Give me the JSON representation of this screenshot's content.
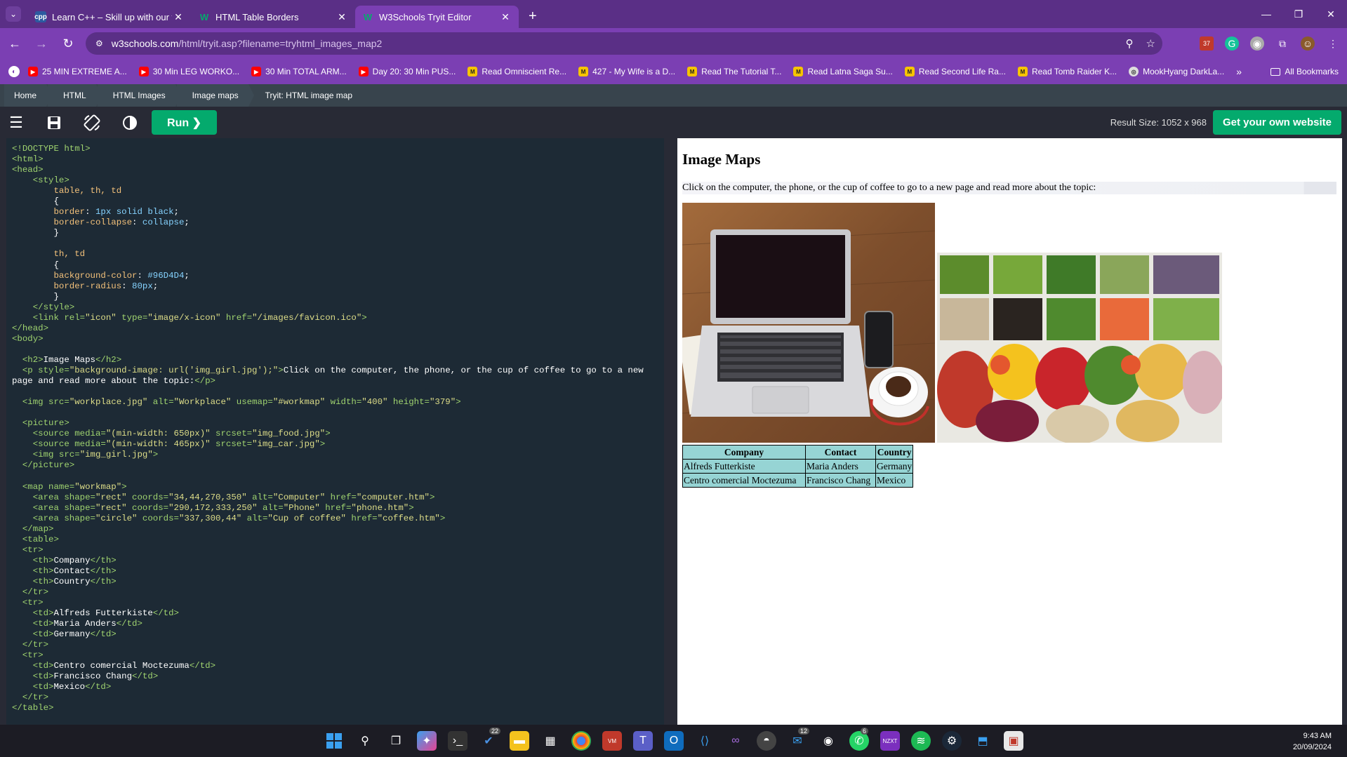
{
  "browser": {
    "tabs": [
      {
        "label": "Learn C++ – Skill up with our fr",
        "favicon": "cpp-icon"
      },
      {
        "label": "HTML Table Borders",
        "favicon": "w3schools-icon"
      },
      {
        "label": "W3Schools Tryit Editor",
        "favicon": "w3schools-icon",
        "active": true
      }
    ],
    "site_label": "⚙",
    "url_host": "w3schools.com",
    "url_path": "/html/tryit.asp?filename=tryhtml_images_map2",
    "ext_badge": "37"
  },
  "bookmarks": [
    {
      "label": "25 MIN EXTREME A...",
      "icon": "youtube-icon"
    },
    {
      "label": "30 Min LEG WORKO...",
      "icon": "youtube-icon"
    },
    {
      "label": "30 Min TOTAL ARM...",
      "icon": "youtube-icon"
    },
    {
      "label": "Day 20: 30 Min PUS...",
      "icon": "youtube-icon"
    },
    {
      "label": "Read Omniscient Re...",
      "icon": "manga-icon"
    },
    {
      "label": "427 - My Wife is a D...",
      "icon": "manga-icon"
    },
    {
      "label": "Read The Tutorial T...",
      "icon": "manga-icon"
    },
    {
      "label": "Read Latna Saga Su...",
      "icon": "manga-icon"
    },
    {
      "label": "Read Second Life Ra...",
      "icon": "manga-icon"
    },
    {
      "label": "Read Tomb Raider K...",
      "icon": "manga-icon"
    },
    {
      "label": "MookHyang DarkLa...",
      "icon": "globe-icon"
    }
  ],
  "bookmarks_more": "»",
  "bookmarks_all": "All Bookmarks",
  "breadcrumb": [
    "Home",
    "HTML",
    "HTML Images",
    "Image maps"
  ],
  "breadcrumb_current": "Tryit: HTML image map",
  "toolbar": {
    "run_label": "Run ❯",
    "result_size": "Result Size: 1052 x 968",
    "get_site": "Get your own website"
  },
  "result": {
    "heading": "Image Maps",
    "paragraph": "Click on the computer, the phone, or the cup of coffee to go to a new page and read more about the topic:",
    "table": {
      "headers": [
        "Company",
        "Contact",
        "Country"
      ],
      "rows": [
        [
          "Alfreds Futterkiste",
          "Maria Anders",
          "Germany"
        ],
        [
          "Centro comercial Moctezuma",
          "Francisco Chang",
          "Mexico"
        ]
      ]
    }
  },
  "taskbar": {
    "badges": {
      "todo": "22",
      "mail": "12",
      "whatsapp": "6"
    },
    "time": "9:43 AM",
    "date": "20/09/2024"
  }
}
